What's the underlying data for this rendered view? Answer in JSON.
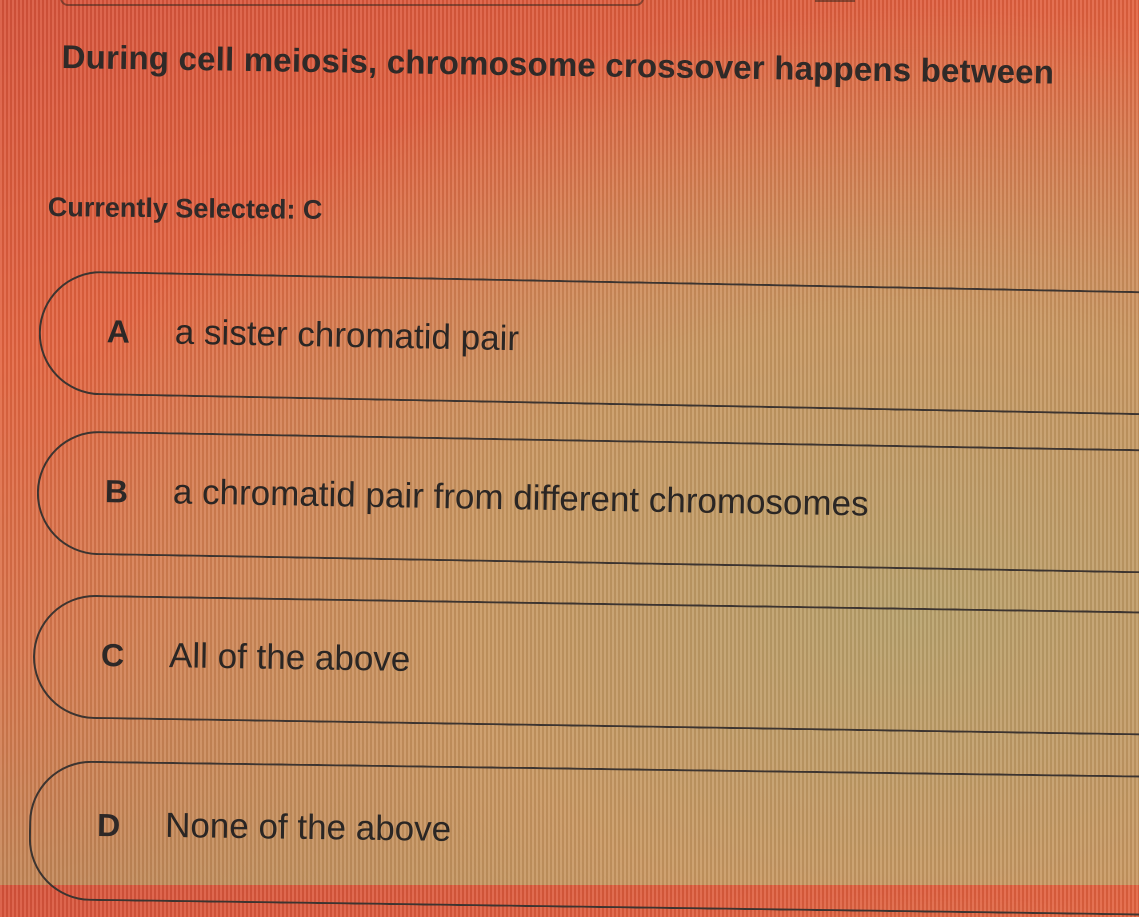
{
  "question": {
    "text": "During cell meiosis, chromosome crossover happens between"
  },
  "selection": {
    "label": "Currently Selected: C"
  },
  "options": [
    {
      "letter": "A",
      "text": "a sister chromatid pair"
    },
    {
      "letter": "B",
      "text": "a chromatid pair from different chromosomes"
    },
    {
      "letter": "C",
      "text": "All of the above"
    },
    {
      "letter": "D",
      "text": "None of the above"
    }
  ]
}
